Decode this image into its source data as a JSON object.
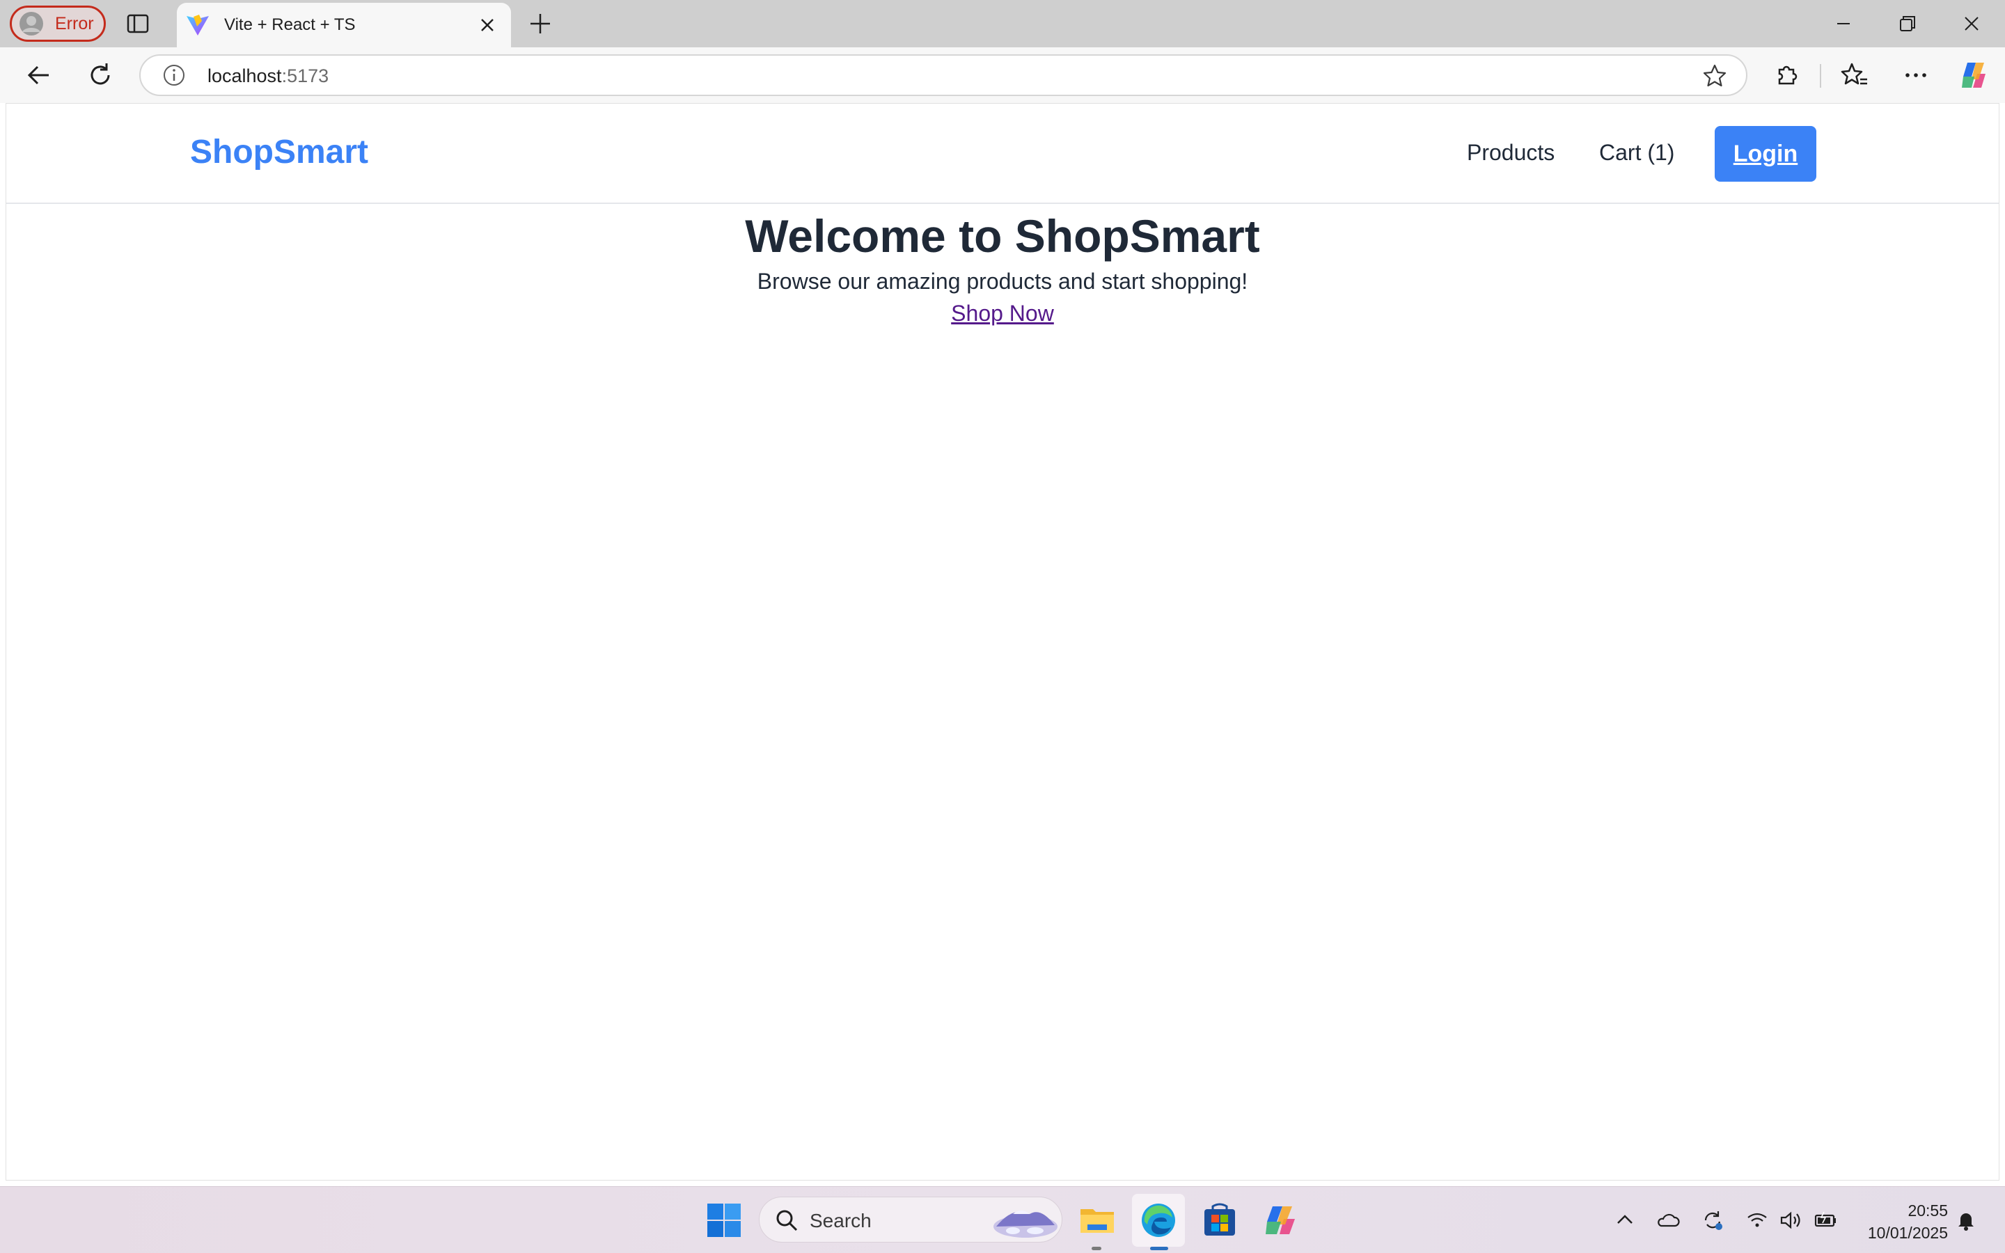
{
  "browser": {
    "profile_label": "Error",
    "tab_title": "Vite + React + TS",
    "url_host": "localhost",
    "url_port": ":5173"
  },
  "site": {
    "brand": "ShopSmart",
    "nav": {
      "products": "Products",
      "cart": "Cart (1)",
      "login": "Login"
    },
    "hero": {
      "title": "Welcome to ShopSmart",
      "subtitle": "Browse our amazing products and start shopping!",
      "cta": "Shop Now"
    },
    "colors": {
      "accent": "#3b82f6",
      "text": "#1f2937",
      "visited_link": "#551a8b"
    }
  },
  "taskbar": {
    "search_placeholder": "Search",
    "time": "20:55",
    "date": "10/01/2025"
  }
}
